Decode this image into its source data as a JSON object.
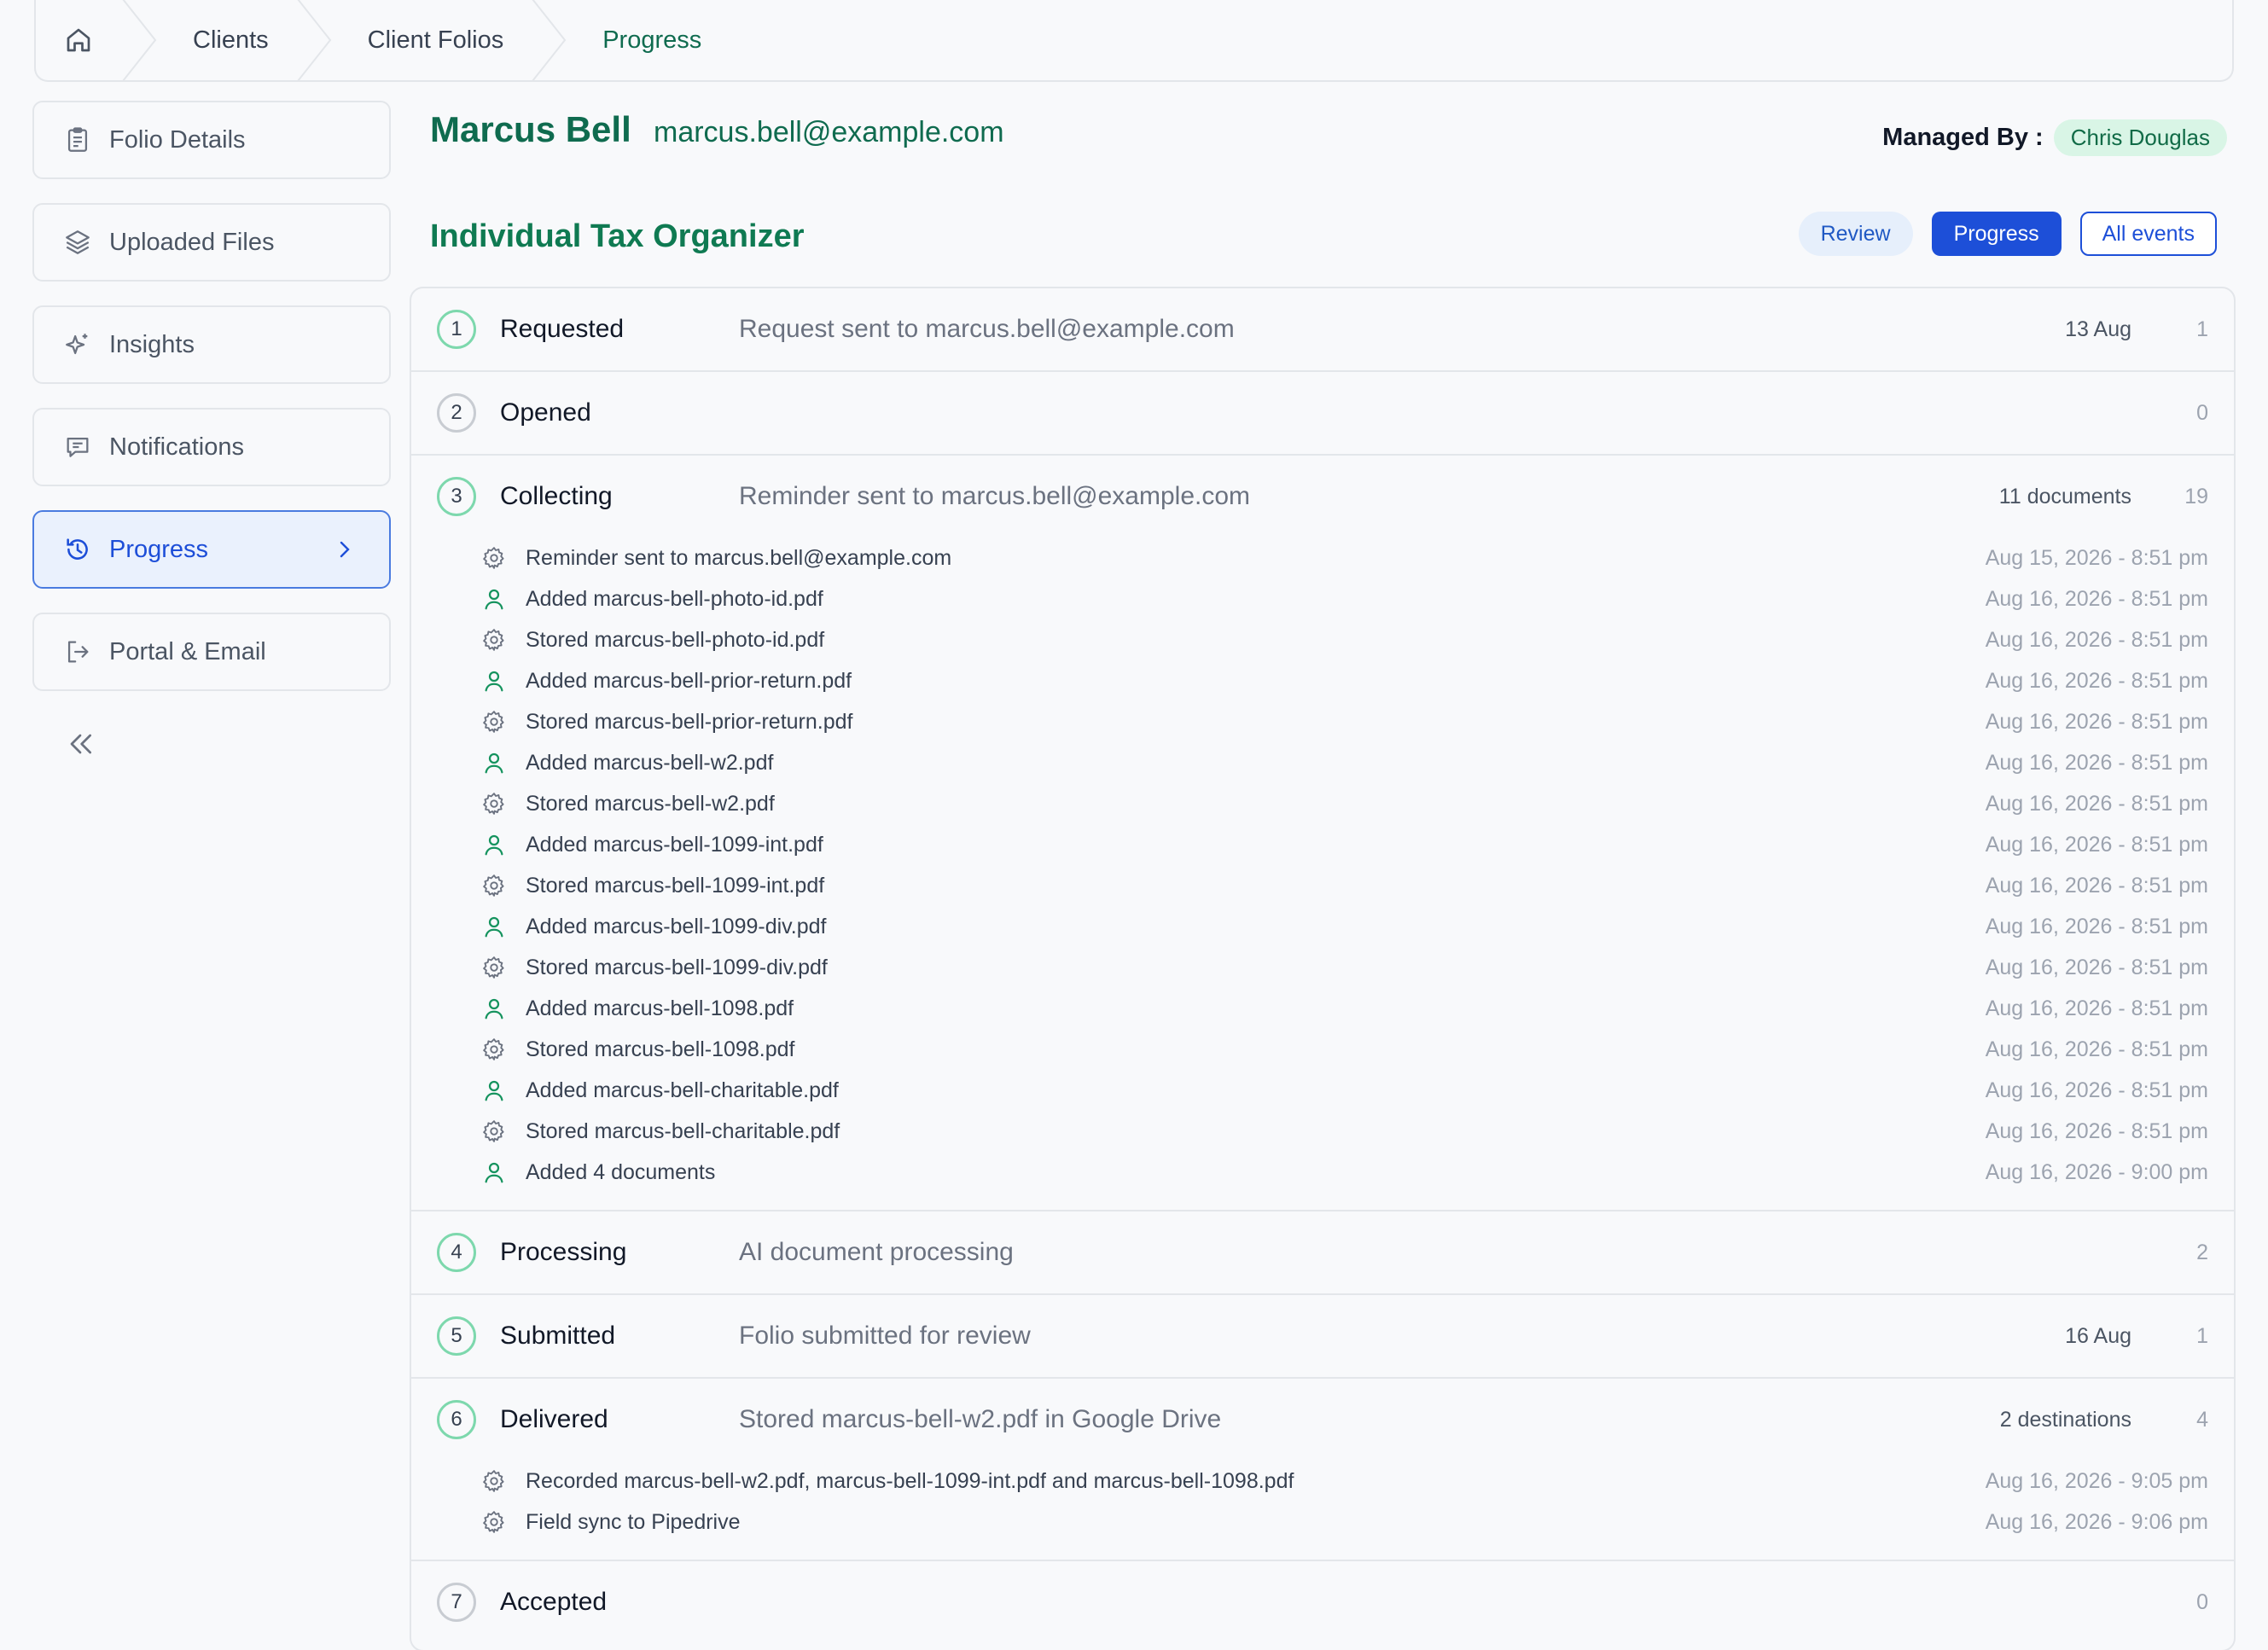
{
  "breadcrumb": {
    "home_icon": "home-icon",
    "items": [
      "Clients",
      "Client Folios",
      "Progress"
    ]
  },
  "sidebar": {
    "items": [
      {
        "label": "Folio Details",
        "icon": "clipboard-icon"
      },
      {
        "label": "Uploaded Files",
        "icon": "layers-icon"
      },
      {
        "label": "Insights",
        "icon": "sparkles-icon"
      },
      {
        "label": "Notifications",
        "icon": "message-icon"
      },
      {
        "label": "Progress",
        "icon": "history-icon",
        "active": true
      },
      {
        "label": "Portal & Email",
        "icon": "logout-icon"
      }
    ],
    "collapse_icon": "chevrons-left-icon"
  },
  "header": {
    "client_name": "Marcus Bell",
    "client_email": "marcus.bell@example.com",
    "managed_by_label": "Managed By :",
    "managed_by": "Chris Douglas"
  },
  "organizer": {
    "title": "Individual Tax Organizer",
    "tabs": [
      "Review",
      "Progress",
      "All events"
    ],
    "active_tab": "Progress"
  },
  "stages": [
    {
      "num": "1",
      "label": "Requested",
      "desc": "Request sent to marcus.bell@example.com",
      "meta": "13 Aug",
      "count": "1"
    },
    {
      "num": "2",
      "label": "Opened",
      "desc": "",
      "meta": "",
      "count": "0"
    },
    {
      "num": "3",
      "label": "Collecting",
      "desc": "Reminder sent to marcus.bell@example.com",
      "meta": "11 documents",
      "count": "19",
      "events": [
        {
          "type": "system",
          "text": "Reminder sent to marcus.bell@example.com",
          "time": "Aug 15, 2026 - 8:51 pm"
        },
        {
          "type": "user",
          "text": "Added marcus-bell-photo-id.pdf",
          "time": "Aug 16, 2026 - 8:51 pm"
        },
        {
          "type": "system",
          "text": "Stored marcus-bell-photo-id.pdf",
          "time": "Aug 16, 2026 - 8:51 pm"
        },
        {
          "type": "user",
          "text": "Added marcus-bell-prior-return.pdf",
          "time": "Aug 16, 2026 - 8:51 pm"
        },
        {
          "type": "system",
          "text": "Stored marcus-bell-prior-return.pdf",
          "time": "Aug 16, 2026 - 8:51 pm"
        },
        {
          "type": "user",
          "text": "Added marcus-bell-w2.pdf",
          "time": "Aug 16, 2026 - 8:51 pm"
        },
        {
          "type": "system",
          "text": "Stored marcus-bell-w2.pdf",
          "time": "Aug 16, 2026 - 8:51 pm"
        },
        {
          "type": "user",
          "text": "Added marcus-bell-1099-int.pdf",
          "time": "Aug 16, 2026 - 8:51 pm"
        },
        {
          "type": "system",
          "text": "Stored marcus-bell-1099-int.pdf",
          "time": "Aug 16, 2026 - 8:51 pm"
        },
        {
          "type": "user",
          "text": "Added marcus-bell-1099-div.pdf",
          "time": "Aug 16, 2026 - 8:51 pm"
        },
        {
          "type": "system",
          "text": "Stored marcus-bell-1099-div.pdf",
          "time": "Aug 16, 2026 - 8:51 pm"
        },
        {
          "type": "user",
          "text": "Added marcus-bell-1098.pdf",
          "time": "Aug 16, 2026 - 8:51 pm"
        },
        {
          "type": "system",
          "text": "Stored marcus-bell-1098.pdf",
          "time": "Aug 16, 2026 - 8:51 pm"
        },
        {
          "type": "user",
          "text": "Added marcus-bell-charitable.pdf",
          "time": "Aug 16, 2026 - 8:51 pm"
        },
        {
          "type": "system",
          "text": "Stored marcus-bell-charitable.pdf",
          "time": "Aug 16, 2026 - 8:51 pm"
        },
        {
          "type": "user",
          "text": "Added 4 documents",
          "time": "Aug 16, 2026 - 9:00 pm"
        }
      ]
    },
    {
      "num": "4",
      "label": "Processing",
      "desc": "AI document processing",
      "meta": "",
      "count": "2"
    },
    {
      "num": "5",
      "label": "Submitted",
      "desc": "Folio submitted for review",
      "meta": "16 Aug",
      "count": "1"
    },
    {
      "num": "6",
      "label": "Delivered",
      "desc": "Stored marcus-bell-w2.pdf in Google Drive",
      "meta": "2 destinations",
      "count": "4",
      "events": [
        {
          "type": "system",
          "text": "Recorded marcus-bell-w2.pdf, marcus-bell-1099-int.pdf and marcus-bell-1098.pdf",
          "time": "Aug 16, 2026 - 9:05 pm"
        },
        {
          "type": "system",
          "text": "Field sync to Pipedrive",
          "time": "Aug 16, 2026 - 9:06 pm"
        }
      ]
    },
    {
      "num": "7",
      "label": "Accepted",
      "desc": "",
      "meta": "",
      "count": "0"
    }
  ],
  "colors": {
    "accent_green": "#0f6b4f",
    "primary_blue": "#1d4fd8",
    "ring_green": "#7dd8ad"
  }
}
